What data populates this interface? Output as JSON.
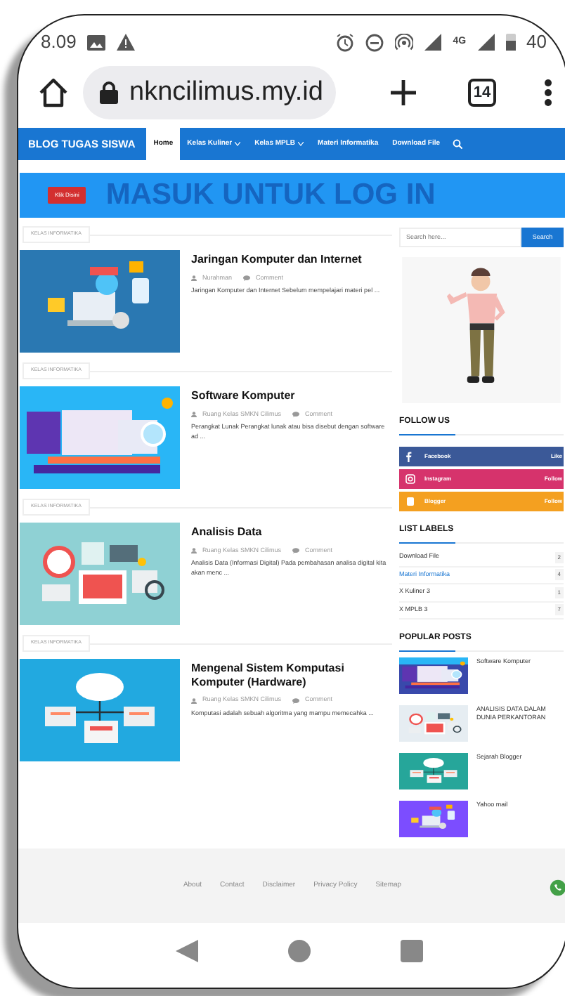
{
  "status_bar": {
    "time": "8.09",
    "network": "4G",
    "battery": "40"
  },
  "browser": {
    "url": "nkncilimus.my.id",
    "tab_count": "14"
  },
  "site": {
    "brand": "BLOG TUGAS SISWA",
    "nav": [
      {
        "label": "Home",
        "selected": true,
        "dropdown": false
      },
      {
        "label": "Kelas Kuliner",
        "selected": false,
        "dropdown": true
      },
      {
        "label": "Kelas MPLB",
        "selected": false,
        "dropdown": true
      },
      {
        "label": "Materi Informatika",
        "selected": false,
        "dropdown": false
      },
      {
        "label": "Download File",
        "selected": false,
        "dropdown": false
      }
    ],
    "banner": {
      "button": "Klik Disini",
      "text": "MASUK UNTUK LOG IN"
    },
    "posts": [
      {
        "label": "KELAS INFORMATIKA",
        "title": "Jaringan Komputer dan Internet",
        "author": "Nurahman",
        "comments": "Comment",
        "excerpt": "Jaringan Komputer dan Internet     Sebelum mempelajari materi pel ..."
      },
      {
        "label": "KELAS INFORMATIKA",
        "title": "Software Komputer",
        "author": "Ruang Kelas SMKN Cilimus",
        "comments": "Comment",
        "excerpt": "Perangkat Lunak     Perangkat lunak atau bisa disebut dengan software ad ..."
      },
      {
        "label": "KELAS INFORMATIKA",
        "title": "Analisis Data",
        "author": "Ruang Kelas SMKN Cilimus",
        "comments": "Comment",
        "excerpt": "Analisis Data (Informasi Digital)    Pada pembahasan analisa digital kita akan menc ..."
      },
      {
        "label": "KELAS INFORMATIKA",
        "title": "Mengenal Sistem Komputasi Komputer (Hardware)",
        "author": "Ruang Kelas SMKN Cilimus",
        "comments": "Comment",
        "excerpt": "Komputasi adalah sebuah algoritma yang mampu memecahka ..."
      }
    ],
    "search": {
      "placeholder": "Search here...",
      "button": "Search"
    },
    "follow": {
      "title": "FOLLOW US",
      "items": [
        {
          "label": "Facebook",
          "action": "Like",
          "color": "#3b5998"
        },
        {
          "label": "Instagram",
          "action": "Follow",
          "color": "#d6336c"
        },
        {
          "label": "Blogger",
          "action": "Follow",
          "color": "#f4a020"
        }
      ]
    },
    "labels": {
      "title": "LIST LABELS",
      "items": [
        {
          "name": "Download File",
          "count": "2",
          "selected": false
        },
        {
          "name": "Materi Informatika",
          "count": "4",
          "selected": true
        },
        {
          "name": "X Kuliner 3",
          "count": "1",
          "selected": false
        },
        {
          "name": "X MPLB 3",
          "count": "7",
          "selected": false
        }
      ]
    },
    "popular": {
      "title": "POPULAR POSTS",
      "items": [
        {
          "title": "Software Komputer"
        },
        {
          "title": "ANALISIS DATA DALAM DUNIA PERKANTORAN"
        },
        {
          "title": "Sejarah Blogger"
        },
        {
          "title": "Yahoo mail"
        }
      ]
    },
    "footer": {
      "links": [
        "About",
        "Contact",
        "Disclaimer",
        "Privacy Policy",
        "Sitemap"
      ]
    }
  }
}
